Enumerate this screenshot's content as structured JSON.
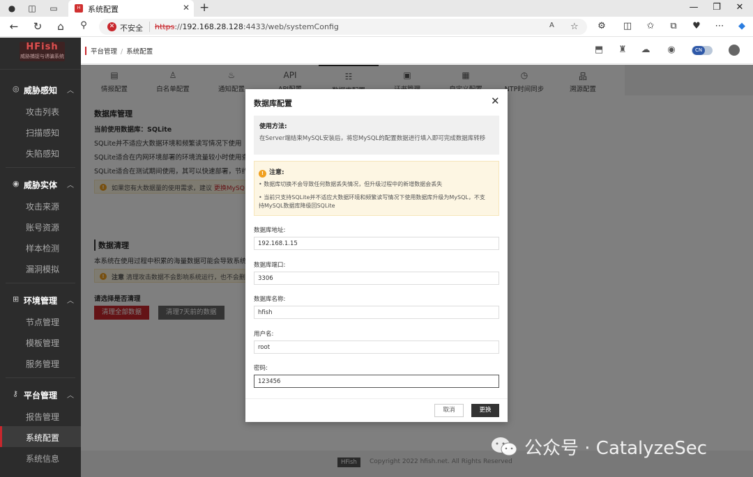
{
  "browser": {
    "tab_title": "系统配置",
    "favicon_text": "HFish",
    "address": {
      "security_label": "不安全",
      "scheme": "https",
      "host": "192.168.28.128",
      "rest": ":4433/web/systemConfig"
    }
  },
  "sidebar": {
    "logo_title": "HFish",
    "logo_subtitle": "威胁捕捉与诱骗系统",
    "groups": [
      {
        "label": "威胁感知",
        "items": [
          "攻击列表",
          "扫描感知",
          "失陷感知"
        ]
      },
      {
        "label": "威胁实体",
        "items": [
          "攻击来源",
          "账号资源",
          "样本检测",
          "漏洞模拟"
        ]
      },
      {
        "label": "环境管理",
        "items": [
          "节点管理",
          "模板管理",
          "服务管理"
        ]
      },
      {
        "label": "平台管理",
        "items": [
          "报告管理",
          "系统配置",
          "系统信息"
        ]
      }
    ],
    "active_item": "系统配置"
  },
  "header": {
    "breadcrumb": [
      "平台管理",
      "系统配置"
    ],
    "lang": "CN"
  },
  "config_tabs": [
    {
      "icon": "▤",
      "label": "情报配置"
    },
    {
      "icon": "♙",
      "label": "白名单配置"
    },
    {
      "icon": "♨",
      "label": "通知配置"
    },
    {
      "icon": "API",
      "label": "API配置"
    },
    {
      "icon": "☷",
      "label": "数据库配置"
    },
    {
      "icon": "▣",
      "label": "证书管理"
    },
    {
      "icon": "▦",
      "label": "自定义配置"
    },
    {
      "icon": "◷",
      "label": "NTP时间同步"
    },
    {
      "icon": "品",
      "label": "溯源配置"
    }
  ],
  "page": {
    "db_title": "数据库管理",
    "current_db": "当前使用数据库：SQLite",
    "lines": [
      "SQLite并不适应大数据环境和频繁读写情况下使用",
      "SQLite适合在内网环境部署的环境流量较小时使用查看",
      "SQLite适合在测试期间使用，其可以快速部署，节约时"
    ],
    "tip_text": "如果您有大数据量的使用需求，建议",
    "tip_link": "更换MySQ",
    "clean_title": "数据清理",
    "clean_desc": "本系统在使用过程中积累的海量数据可能会导致系统运行",
    "clean_note_head": "注意",
    "clean_note": "清理攻击数据不会影响系统运行，也不会删",
    "choose_label": "请选择是否清理",
    "btn_clear_all": "清理全部数据",
    "btn_clear_7": "清理7天前的数据"
  },
  "footer": {
    "logo": "HFish",
    "copyright": "Copyright 2022 hfish.net. All Rights Reserved"
  },
  "modal": {
    "title": "数据库配置",
    "usage_title": "使用方法:",
    "usage_body": "在Server端结束MySQL安装后，将您MySQL的配置数据进行填入即可完成数据库转移",
    "notice_title": "注意:",
    "notice_items": [
      "数据库切换不会导致任何数据丢失情况，但升级过程中的新增数据会丢失",
      "当前只支持SQLite并不适应大数据环境和频繁读写情况下使用数据库升级为MySQL，不支持MySQL数据库降级回SQLite"
    ],
    "fields": [
      {
        "label": "数据库地址:",
        "value": "192.168.1.15"
      },
      {
        "label": "数据库端口:",
        "value": "3306"
      },
      {
        "label": "数据库名称:",
        "value": "hfish"
      },
      {
        "label": "用户名:",
        "value": "root"
      },
      {
        "label": "密码:",
        "value": "123456"
      }
    ],
    "cancel_label": "取消",
    "submit_label": "更换"
  },
  "watermark": "公众号 · CatalyzeSec",
  "colors": {
    "accent": "#c8272d",
    "sidebar_bg": "#2c2c2c",
    "primary_btn": "#333333"
  }
}
